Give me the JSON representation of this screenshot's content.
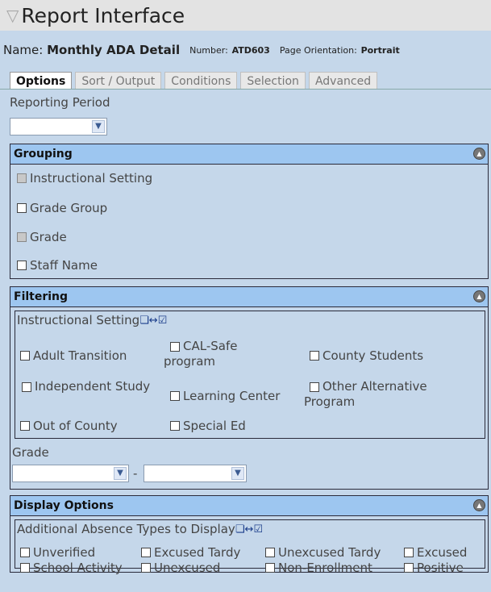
{
  "app": {
    "title": "Report Interface"
  },
  "report": {
    "name_label": "Name:",
    "name_value": "Monthly ADA Detail",
    "number_label": "Number:",
    "number_value": "ATD603",
    "orientation_label": "Page Orientation:",
    "orientation_value": "Portrait"
  },
  "tabs": [
    {
      "label": "Options",
      "active": true
    },
    {
      "label": "Sort / Output",
      "active": false
    },
    {
      "label": "Conditions",
      "active": false
    },
    {
      "label": "Selection",
      "active": false
    },
    {
      "label": "Advanced",
      "active": false
    }
  ],
  "reporting_period": {
    "label": "Reporting Period",
    "value": ""
  },
  "grouping": {
    "title": "Grouping",
    "items": [
      {
        "label": "Instructional Setting",
        "disabled": true
      },
      {
        "label": "Grade Group",
        "disabled": false
      },
      {
        "label": "Grade",
        "disabled": true
      },
      {
        "label": "Staff Name",
        "disabled": false
      }
    ]
  },
  "filtering": {
    "title": "Filtering",
    "instructional_setting_label": "Instructional Setting",
    "items": [
      "Adult Transition",
      "CAL-Safe program",
      "County Students",
      "Independent Study",
      "Learning Center",
      "Other Alternative Program",
      "Out of County",
      "Special Ed"
    ],
    "grade_label": "Grade",
    "grade_range_separator": "-",
    "grade_from": "",
    "grade_to": ""
  },
  "display_options": {
    "title": "Display Options",
    "absence_types_label": "Additional Absence Types to Display",
    "items": [
      "Unverified",
      "Excused Tardy",
      "Unexcused Tardy",
      "Excused",
      "School Activity",
      "Unexcused",
      "Non-Enrollment",
      "Positive"
    ]
  },
  "icons": {
    "filter": "funnel-icon",
    "collapse": "collapse-icon",
    "select_all_toggle": "toggle-select-all-icon",
    "dropdown": "chevron-down-icon"
  },
  "colors": {
    "background": "#c5d7ea",
    "section_header": "#9dc6f0",
    "title_bar": "#e3e3e3"
  }
}
